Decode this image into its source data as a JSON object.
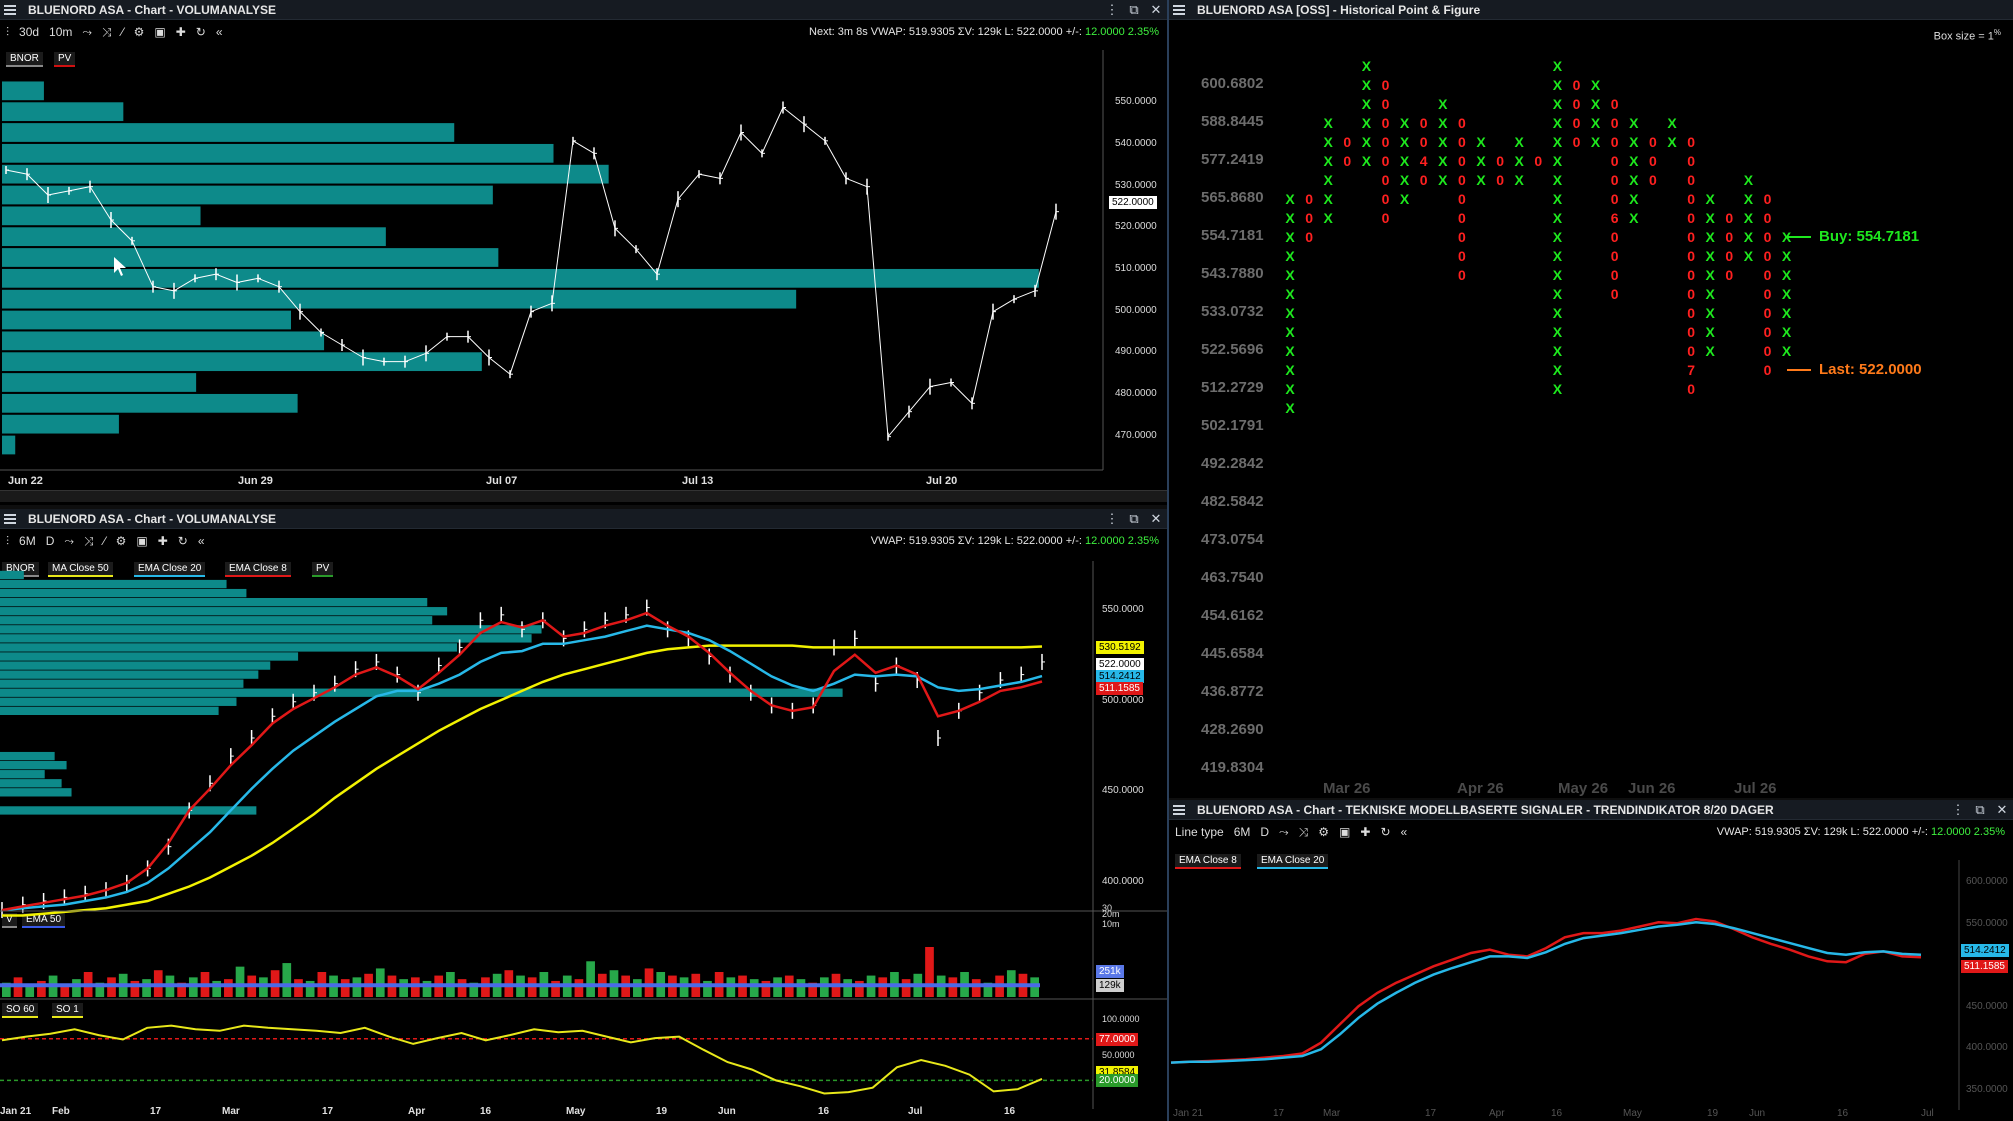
{
  "colors": {
    "bg": "#000000",
    "teal": "#0d8a8a",
    "green_x": "#1ee81e",
    "red_o": "#ff2020",
    "titlebar": "#161b22"
  },
  "p1": {
    "title": "BLUENORD ASA - Chart - VOLUMANALYSE",
    "toolbar": {
      "range": "30d",
      "interval": "10m",
      "info_prefix": "Next: 3m 8s  VWAP: 519.9305  ΣV: 129k  L: 522.0000  +/-: ",
      "info_change": "12.0000  2.35%"
    },
    "chips": [
      {
        "label": "BNOR",
        "color": "#888888"
      },
      {
        "label": "PV",
        "color": "#d01010"
      }
    ],
    "price_tag": "522.0000",
    "y_ticks": [
      "550.0000",
      "540.0000",
      "530.0000",
      "520.0000",
      "510.0000",
      "500.0000",
      "490.0000",
      "480.0000",
      "470.0000"
    ],
    "x_labels": [
      "Jun 22",
      "Jun 29",
      "Jul 07",
      "Jul 13",
      "Jul 20"
    ]
  },
  "p2": {
    "title": "BLUENORD ASA - Chart - VOLUMANALYSE",
    "toolbar": {
      "range": "6M",
      "interval": "D",
      "info_prefix": "VWAP: 519.9305  ΣV: 129k  L: 522.0000  +/-: ",
      "info_change": "12.0000  2.35%"
    },
    "chips": [
      {
        "label": "BNOR",
        "color": "#888888"
      },
      {
        "label": "MA Close 50",
        "color": "#e8e81a"
      },
      {
        "label": "EMA Close 20",
        "color": "#27b8e8"
      },
      {
        "label": "EMA Close 8",
        "color": "#e01818"
      },
      {
        "label": "PV",
        "color": "#2a9a2a"
      }
    ],
    "tags": [
      {
        "label": "530.5192",
        "bg": "#f2f200",
        "fg": "#000"
      },
      {
        "label": "522.0000",
        "bg": "#ffffff",
        "fg": "#000"
      },
      {
        "label": "514.2412",
        "bg": "#27b8e8",
        "fg": "#000"
      },
      {
        "label": "511.1585",
        "bg": "#e01818",
        "fg": "#fff"
      }
    ],
    "y_ticks": [
      "550.0000",
      "500.0000",
      "450.0000",
      "400.0000"
    ],
    "vol_chips": [
      {
        "label": "V",
        "color": "#888888"
      },
      {
        "label": "EMA 50",
        "color": "#3a5ae8"
      }
    ],
    "vol_axis": [
      "30",
      "20m",
      "10m"
    ],
    "vol_tags": [
      {
        "label": "251k",
        "bg": "#5a78e8",
        "fg": "#fff"
      },
      {
        "label": "129k",
        "bg": "#cfcfcf",
        "fg": "#000"
      }
    ],
    "so_chips": [
      {
        "label": "SO 60",
        "color": "#e8e81a"
      },
      {
        "label": "SO 1",
        "color": "#e8e81a"
      }
    ],
    "so_axis": [
      "100.0000",
      "50.0000"
    ],
    "so_tags": [
      {
        "label": "77.0000",
        "bg": "#e01818",
        "fg": "#fff"
      },
      {
        "label": "31.8584",
        "bg": "#f2f200",
        "fg": "#000"
      },
      {
        "label": "20.0000",
        "bg": "#2a9a2a",
        "fg": "#fff"
      }
    ],
    "x_labels": [
      "Jan 21",
      "Feb",
      "17",
      "Mar",
      "17",
      "Apr",
      "16",
      "May",
      "19",
      "Jun",
      "16",
      "Jul",
      "16"
    ]
  },
  "p3": {
    "title": "BLUENORD ASA [OSS] - Historical Point & Figure",
    "box_size": "Box size = 1",
    "box_unit": "%",
    "prices": [
      "600.6802",
      "588.8445",
      "577.2419",
      "565.8680",
      "554.7181",
      "543.7880",
      "533.0732",
      "522.5696",
      "512.2729",
      "502.1791",
      "492.2842",
      "482.5842",
      "473.0754",
      "463.7540",
      "454.6162",
      "445.6584",
      "436.8772",
      "428.2690",
      "419.8304"
    ],
    "buy_label": "Buy: 554.7181",
    "last_label": "Last: 522.0000",
    "x_labels": [
      "Mar 26",
      "Apr 26",
      "May 26",
      "Jun 26",
      "Jul 26"
    ],
    "columns": [
      {
        "t": "X",
        "top": 7,
        "len": 12,
        "marks": {}
      },
      {
        "t": "O",
        "top": 7,
        "len": 3,
        "marks": {}
      },
      {
        "t": "X",
        "top": 3,
        "len": 6,
        "marks": {}
      },
      {
        "t": "O",
        "top": 4,
        "len": 2,
        "marks": {}
      },
      {
        "t": "X",
        "top": 0,
        "len": 6,
        "marks": {}
      },
      {
        "t": "O",
        "top": 1,
        "len": 8,
        "marks": {}
      },
      {
        "t": "X",
        "top": 3,
        "len": 5,
        "marks": {}
      },
      {
        "t": "O",
        "top": 3,
        "len": 4,
        "marks": {
          "2": "4"
        }
      },
      {
        "t": "X",
        "top": 2,
        "len": 5,
        "marks": {}
      },
      {
        "t": "O",
        "top": 3,
        "len": 9,
        "marks": {}
      },
      {
        "t": "X",
        "top": 4,
        "len": 3,
        "marks": {}
      },
      {
        "t": "O",
        "top": 5,
        "len": 2,
        "marks": {}
      },
      {
        "t": "X",
        "top": 4,
        "len": 3,
        "marks": {}
      },
      {
        "t": "O",
        "top": 5,
        "len": 1,
        "marks": {}
      },
      {
        "t": "X",
        "top": 0,
        "len": 18,
        "marks": {}
      },
      {
        "t": "O",
        "top": 1,
        "len": 4,
        "marks": {}
      },
      {
        "t": "X",
        "top": 1,
        "len": 4,
        "marks": {}
      },
      {
        "t": "O",
        "top": 2,
        "len": 11,
        "marks": {
          "6": "6"
        }
      },
      {
        "t": "X",
        "top": 3,
        "len": 6,
        "marks": {}
      },
      {
        "t": "O",
        "top": 4,
        "len": 3,
        "marks": {}
      },
      {
        "t": "X",
        "top": 3,
        "len": 2,
        "marks": {}
      },
      {
        "t": "O",
        "top": 4,
        "len": 14,
        "marks": {
          "12": "7"
        }
      },
      {
        "t": "X",
        "top": 7,
        "len": 9,
        "marks": {}
      },
      {
        "t": "O",
        "top": 8,
        "len": 4,
        "marks": {}
      },
      {
        "t": "X",
        "top": 6,
        "len": 5,
        "marks": {}
      },
      {
        "t": "O",
        "top": 7,
        "len": 10,
        "marks": {}
      },
      {
        "t": "X",
        "top": 9,
        "len": 7,
        "marks": {}
      }
    ]
  },
  "p4": {
    "title": "BLUENORD ASA - Chart - TEKNISKE MODELLBASERTE SIGNALER - TRENDINDIKATOR 8/20 DAGER",
    "toolbar": {
      "line_type": "Line type",
      "range": "6M",
      "interval": "D",
      "info_prefix": "VWAP: 519.9305  ΣV: 129k  L: 522.0000  +/-: ",
      "info_change": "12.0000  2.35%"
    },
    "chips": [
      {
        "label": "EMA Close 8",
        "color": "#e01818"
      },
      {
        "label": "EMA Close 20",
        "color": "#27b8e8"
      }
    ],
    "tags": [
      {
        "label": "514.2412",
        "bg": "#27b8e8",
        "fg": "#000"
      },
      {
        "label": "511.1585",
        "bg": "#e01818",
        "fg": "#fff"
      }
    ],
    "y_ticks": [
      "600.0000",
      "550.0000",
      "500.0000",
      "450.0000",
      "400.0000",
      "350.0000"
    ],
    "x_labels": [
      "Jan 21",
      "17",
      "Mar",
      "17",
      "Apr",
      "16",
      "May",
      "19",
      "Jun",
      "16",
      "Jul",
      "16"
    ]
  },
  "chart_data": [
    {
      "type": "bar",
      "title": "BLUENORD ASA - Chart - VOLUMANALYSE (30d / 10m)",
      "ylim": [
        462,
        558
      ],
      "price_x_days": [
        0,
        28
      ],
      "x": [
        0,
        0.5,
        1,
        1.5,
        2,
        2.5,
        3,
        3.5,
        4,
        4.5,
        5,
        5.5,
        6,
        6.5,
        7,
        7.5,
        8,
        8.5,
        9,
        9.5,
        10,
        10.5,
        11,
        11.5,
        12,
        12.5,
        13,
        13.5,
        14,
        14.5,
        15,
        15.5,
        16,
        16.5,
        17,
        17.5,
        18,
        18.5,
        19,
        19.5,
        20,
        20.5,
        21,
        21.5,
        22,
        22.5,
        23,
        23.5,
        24,
        24.5,
        25
      ],
      "close": [
        534,
        533,
        528,
        529,
        530,
        522,
        517,
        506,
        505,
        508,
        509,
        507,
        508,
        506,
        500,
        495,
        492,
        489,
        488,
        488,
        490,
        494,
        494,
        489,
        485,
        500,
        502,
        541,
        538,
        520,
        515,
        509,
        527,
        533,
        532,
        543,
        538,
        549,
        545,
        541,
        532,
        530,
        470,
        476,
        482,
        483,
        478,
        500,
        503,
        505,
        524
      ],
      "volume_profile": [
        {
          "price": 553,
          "volume": 38
        },
        {
          "price": 548,
          "volume": 110
        },
        {
          "price": 543,
          "volume": 410
        },
        {
          "price": 538,
          "volume": 500
        },
        {
          "price": 533,
          "volume": 550
        },
        {
          "price": 528,
          "volume": 445
        },
        {
          "price": 523,
          "volume": 180
        },
        {
          "price": 518,
          "volume": 348
        },
        {
          "price": 513,
          "volume": 450
        },
        {
          "price": 508,
          "volume": 940
        },
        {
          "price": 503,
          "volume": 720
        },
        {
          "price": 498,
          "volume": 262
        },
        {
          "price": 493,
          "volume": 292
        },
        {
          "price": 488,
          "volume": 435
        },
        {
          "price": 483,
          "volume": 176
        },
        {
          "price": 478,
          "volume": 268
        },
        {
          "price": 473,
          "volume": 106
        },
        {
          "price": 468,
          "volume": 12
        }
      ]
    },
    {
      "type": "line",
      "title": "BLUENORD ASA - Chart - VOLUMANALYSE (6M / D)",
      "ylim": [
        390,
        570
      ],
      "x_months": [
        0,
        0.5,
        1,
        1.5,
        2,
        2.5,
        3,
        3.5,
        4,
        4.5,
        5,
        5.5,
        6,
        6.5,
        7,
        7.5,
        8,
        8.5,
        9,
        9.5,
        10,
        10.5,
        11,
        11.5,
        12,
        12.5,
        13,
        13.5,
        14,
        14.5,
        15,
        15.5,
        16,
        16.5,
        17,
        17.5,
        18,
        18.5,
        19,
        19.5,
        20,
        20.5,
        21,
        21.5,
        22,
        22.5,
        23,
        23.5,
        24,
        24.5,
        25
      ],
      "series": [
        {
          "name": "BNOR",
          "values": [
            385,
            388,
            390,
            392,
            394,
            396,
            400,
            408,
            420,
            440,
            455,
            470,
            480,
            492,
            500,
            505,
            510,
            518,
            522,
            515,
            505,
            520,
            530,
            545,
            548,
            540,
            545,
            535,
            540,
            545,
            548,
            552,
            540,
            535,
            525,
            515,
            505,
            498,
            495,
            498,
            530,
            535,
            510,
            520,
            512,
            480,
            495,
            505,
            512,
            515,
            522
          ]
        },
        {
          "name": "MA Close 50",
          "values": [
            382,
            382,
            383,
            384,
            385,
            386,
            388,
            390,
            394,
            398,
            403,
            409,
            415,
            422,
            430,
            438,
            447,
            455,
            463,
            470,
            477,
            484,
            490,
            496,
            501,
            506,
            511,
            515,
            518,
            521,
            524,
            527,
            529,
            530,
            531,
            531,
            531,
            531,
            531,
            530,
            530,
            530,
            530,
            530,
            530,
            530,
            530,
            530,
            530,
            530,
            530.5
          ]
        },
        {
          "name": "EMA Close 20",
          "values": [
            385,
            386,
            387,
            388,
            390,
            392,
            395,
            400,
            408,
            418,
            428,
            440,
            452,
            463,
            473,
            481,
            489,
            496,
            503,
            506,
            506,
            510,
            515,
            522,
            527,
            528,
            532,
            532,
            534,
            536,
            539,
            542,
            540,
            538,
            534,
            528,
            521,
            514,
            509,
            506,
            510,
            515,
            514,
            515,
            514,
            508,
            506,
            507,
            509,
            511,
            514.2
          ]
        },
        {
          "name": "EMA Close 8",
          "values": [
            385,
            387,
            389,
            391,
            393,
            396,
            400,
            408,
            422,
            440,
            452,
            465,
            476,
            488,
            496,
            502,
            508,
            515,
            519,
            514,
            507,
            516,
            526,
            538,
            544,
            541,
            545,
            536,
            538,
            542,
            545,
            549,
            542,
            536,
            527,
            516,
            506,
            498,
            495,
            497,
            517,
            526,
            516,
            520,
            515,
            492,
            495,
            500,
            506,
            508,
            511.2
          ]
        }
      ],
      "volume_profile": [
        {
          "price": 570,
          "volume": 24
        },
        {
          "price": 565,
          "volume": 228
        },
        {
          "price": 560,
          "volume": 248
        },
        {
          "price": 555,
          "volume": 430
        },
        {
          "price": 550,
          "volume": 450
        },
        {
          "price": 545,
          "volume": 435
        },
        {
          "price": 540,
          "volume": 545
        },
        {
          "price": 535,
          "volume": 535
        },
        {
          "price": 530,
          "volume": 460
        },
        {
          "price": 525,
          "volume": 300
        },
        {
          "price": 520,
          "volume": 272
        },
        {
          "price": 515,
          "volume": 260
        },
        {
          "price": 510,
          "volume": 245
        },
        {
          "price": 505,
          "volume": 848
        },
        {
          "price": 500,
          "volume": 238
        },
        {
          "price": 495,
          "volume": 220
        },
        {
          "price": 470,
          "volume": 55
        },
        {
          "price": 465,
          "volume": 67
        },
        {
          "price": 460,
          "volume": 45
        },
        {
          "price": 455,
          "volume": 62
        },
        {
          "price": 450,
          "volume": 72
        },
        {
          "price": 440,
          "volume": 258
        }
      ]
    },
    {
      "type": "bar",
      "title": "Volume (V) with EMA 50",
      "values": [
        40,
        55,
        30,
        45,
        60,
        35,
        50,
        70,
        40,
        55,
        65,
        45,
        50,
        75,
        60,
        40,
        55,
        70,
        45,
        50,
        85,
        60,
        55,
        75,
        95,
        50,
        45,
        70,
        60,
        50,
        55,
        65,
        80,
        60,
        50,
        55,
        45,
        60,
        70,
        50,
        40,
        55,
        65,
        75,
        60,
        55,
        70,
        45,
        60,
        50,
        100,
        65,
        75,
        60,
        50,
        80,
        70,
        60,
        55,
        65,
        45,
        70,
        55,
        60,
        50,
        45,
        55,
        60,
        50,
        40,
        55,
        65,
        50,
        45,
        60,
        55,
        70,
        50,
        65,
        140,
        60,
        55,
        70,
        50,
        40,
        60,
        75,
        65,
        55
      ],
      "ema": 55
    },
    {
      "type": "line",
      "title": "SO 60 / SO 1",
      "ylim": [
        0,
        100
      ],
      "values": [
        75,
        80,
        84,
        90,
        82,
        76,
        92,
        95,
        90,
        88,
        95,
        92,
        90,
        88,
        85,
        92,
        80,
        70,
        78,
        85,
        75,
        82,
        90,
        86,
        88,
        80,
        72,
        78,
        80,
        62,
        45,
        35,
        20,
        12,
        2,
        4,
        10,
        38,
        48,
        40,
        28,
        5,
        8,
        22
      ]
    },
    {
      "type": "line",
      "title": "TRENDINDIKATOR 8/20 DAGER",
      "ylim": [
        345,
        610
      ],
      "series": [
        {
          "name": "EMA Close 8",
          "values": [
            384,
            385,
            386,
            387,
            388,
            390,
            392,
            395,
            408,
            430,
            452,
            468,
            480,
            490,
            500,
            508,
            516,
            520,
            514,
            512,
            522,
            535,
            540,
            540,
            543,
            548,
            553,
            552,
            557,
            554,
            545,
            535,
            527,
            520,
            512,
            506,
            505,
            515,
            518,
            512,
            511
          ]
        },
        {
          "name": "EMA Close 20",
          "values": [
            384,
            385,
            385,
            386,
            387,
            388,
            390,
            392,
            400,
            418,
            438,
            455,
            468,
            480,
            490,
            498,
            505,
            512,
            512,
            510,
            517,
            527,
            534,
            537,
            540,
            544,
            548,
            550,
            553,
            551,
            546,
            540,
            534,
            528,
            522,
            516,
            514,
            517,
            518,
            515,
            514
          ]
        }
      ]
    }
  ]
}
